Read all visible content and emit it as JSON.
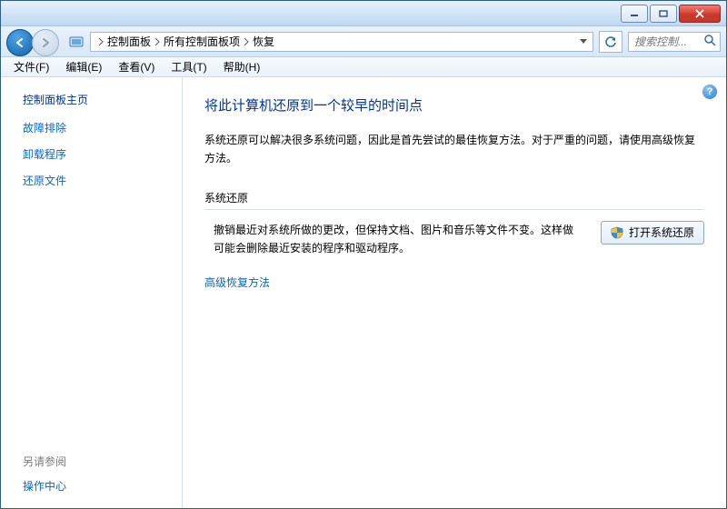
{
  "titlebar": {
    "min_tip": "minimize",
    "max_tip": "maximize",
    "close_tip": "close"
  },
  "nav": {
    "back_tip": "back",
    "forward_tip": "forward",
    "crumbs": [
      "控制面板",
      "所有控制面板项",
      "恢复"
    ],
    "refresh_tip": "refresh"
  },
  "search": {
    "placeholder": "搜索控制..."
  },
  "menu": {
    "items": [
      "文件(F)",
      "编辑(E)",
      "查看(V)",
      "工具(T)",
      "帮助(H)"
    ]
  },
  "sidebar": {
    "home": "控制面板主页",
    "links": [
      "故障排除",
      "卸载程序",
      "还原文件"
    ],
    "see_also_head": "另请参阅",
    "see_also_links": [
      "操作中心"
    ]
  },
  "content": {
    "title": "将此计算机还原到一个较早的时间点",
    "intro": "系统还原可以解决很多系统问题，因此是首先尝试的最佳恢复方法。对于严重的问题，请使用高级恢复方法。",
    "section_head": "系统还原",
    "restore_desc": "撤销最近对系统所做的更改，但保持文档、图片和音乐等文件不变。这样做可能会删除最近安装的程序和驱动程序。",
    "restore_button": "打开系统还原",
    "advanced_link": "高级恢复方法"
  }
}
